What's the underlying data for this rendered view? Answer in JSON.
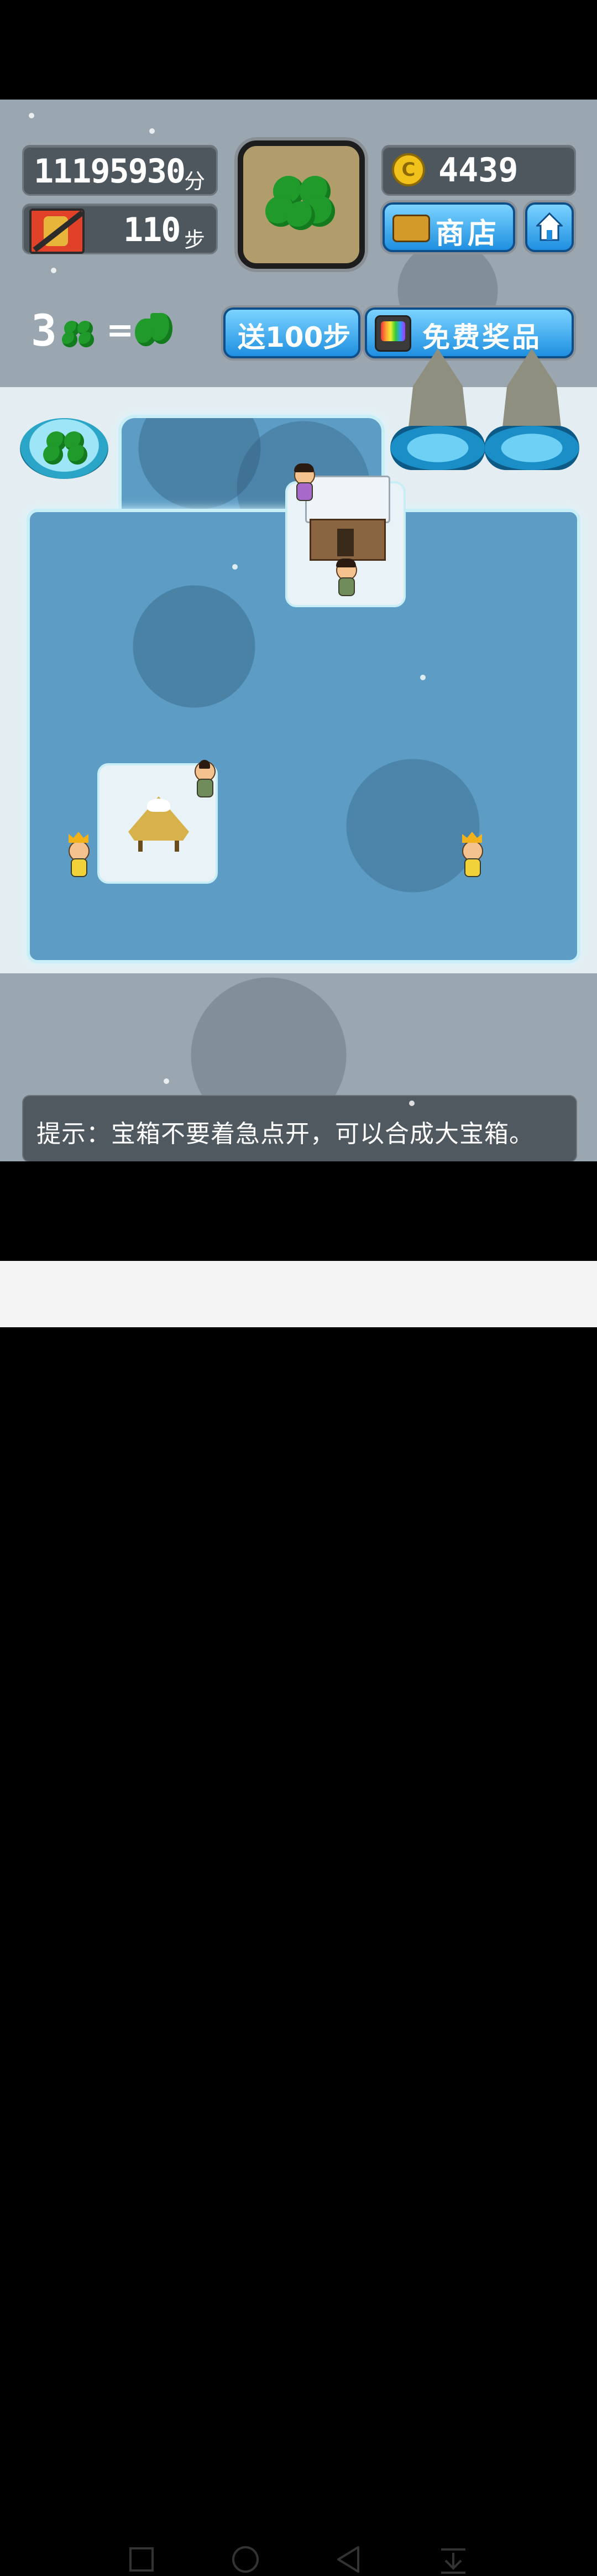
{
  "hud": {
    "score": "11195930",
    "score_unit": "分",
    "steps": "110",
    "steps_unit": "步",
    "coins": "4439",
    "coin_symbol": "C",
    "shop_label": "商店",
    "gift_steps_label": "送100步",
    "free_prize_label": "免费奖品"
  },
  "recipe": {
    "count": "3",
    "equals": "="
  },
  "tip": {
    "text": "提示：宝箱不要着急点开，可以合成大宝箱。"
  },
  "colors": {
    "button_blue": "#1f8fe0",
    "panel_dark": "#4f575e",
    "water": "#5d9cc4",
    "clover_green": "#1f9a2b"
  },
  "icons": {
    "current_item": "four-leaf-clover-icon",
    "steps_item": "no-bear-icon",
    "coin": "coin-icon",
    "shop": "treasure-chest-icon",
    "home": "home-icon",
    "free_prize": "tv-icon",
    "nav": [
      "square-icon",
      "circle-icon",
      "back-triangle-icon",
      "download-icon"
    ]
  }
}
